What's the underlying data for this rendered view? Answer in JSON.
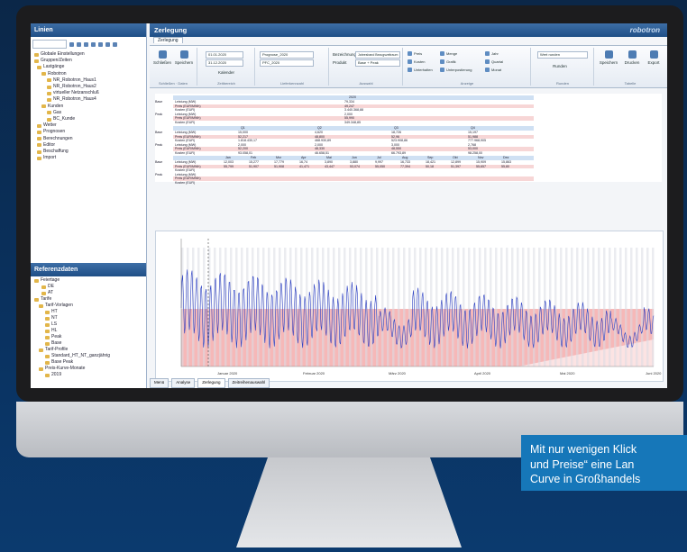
{
  "left_panel": {
    "title": "Linien",
    "tree": [
      "Globale Einstellungen",
      "Gruppen/Zeiten",
      "Lastgänge",
      "Robotron",
      "NR_Robotron_Haus1",
      "NR_Robotron_Haus2",
      "virtueller Netzanschluß",
      "NR_Robotron_Haus4",
      "Kunden",
      "Gas",
      "BC_Kunde",
      "Wetter",
      "Prognosen",
      "Berechnungen",
      "Editor",
      "Beschaffung",
      "Import"
    ]
  },
  "ref_panel": {
    "title": "Referenzdaten",
    "tree": [
      "Feiertage",
      "DE",
      "AT",
      "Tarife",
      "Tarif-Vorlagen",
      "HT",
      "NT",
      "LS",
      "HL",
      "Peak",
      "Base",
      "Tarif-Profile",
      "Standard_HT_NT_ganzjährig",
      "Base Peak",
      "Preis-Kurve-Monate",
      "2019"
    ]
  },
  "main": {
    "title": "Zerlegung",
    "brand": "robotron",
    "ribbon_tab": "Zerlegung",
    "ribbon": {
      "groups": [
        "Schließen",
        "Daten",
        "Zeitbereich",
        "Lieferkennzahl",
        "Auswahl",
        "Anzeige",
        "Runden",
        "Tabelle"
      ],
      "buttons": [
        "Schließen",
        "Speichern",
        "Kalender",
        "Runden",
        "Speichern",
        "Drucken",
        "Export"
      ],
      "date_from": "01.01.2020",
      "date_to": "31.12.2020",
      "prognose": "Prognose_2020",
      "prognose2": "PFC_2020",
      "bezeichnung_label": "Bezeichnung",
      "bezeichnung_value": "Jahresband Bezugszeitraum",
      "produkt_label": "Produkt",
      "produkt_value": "Base + Peak",
      "checks": [
        "Preis",
        "Kosten",
        "Menge",
        "Grafik",
        "Jahr",
        "Quartal",
        "Monat",
        "Wert runden"
      ],
      "checks_extra": [
        "Unterhalten",
        "Unterpostierung"
      ],
      "runden_value": "Wert runden",
      "jahr_value": "Jahr"
    },
    "table": {
      "year": "2020",
      "rows_label_left": [
        "Base",
        "",
        "",
        "",
        "Peak",
        "",
        "",
        ""
      ],
      "row_labels": [
        "Leistung (MW)",
        "Preis (EUR/MWh)",
        "Kosten (EUR)",
        "Leistung (MW)",
        "Preis (EUR/MWh)",
        "Kosten (EUR)"
      ],
      "year_values": [
        "79,334",
        "49,247",
        "3.440.368,88",
        "2,000",
        "55,990",
        "349.348,85"
      ],
      "quarters": [
        "Q1",
        "Q2",
        "Q3",
        "Q4"
      ],
      "quarter_values": [
        [
          "15,000",
          "52,217",
          "1.818.430,17",
          "2,000",
          "52,200",
          "93.058,01"
        ],
        [
          "4,620",
          "48,800",
          "468.930,89",
          "2,000",
          "48,330",
          "46.658,51"
        ],
        [
          "18,726",
          "52,96",
          "523.908,86",
          "3,000",
          "48,550",
          "66.793,89"
        ],
        [
          "15,197",
          "51,988",
          "777.968,905",
          "2,768",
          "53,000",
          "98.258,00"
        ]
      ],
      "months": [
        "Jan",
        "Feb",
        "Mrz",
        "Apr",
        "Mai",
        "Jun",
        "Jul",
        "Aug",
        "Sep",
        "Okt",
        "Nov",
        "Dez"
      ],
      "month_values": [
        [
          "12,003",
          "15,277",
          "17,779",
          "16,74",
          "3,890",
          "3,880",
          "9,997",
          "16,733",
          "18,421",
          "12,899",
          "15,909",
          "15,863"
        ],
        [
          "55,799",
          "51,907",
          "51,908",
          "41,471",
          "43,447",
          "53,074",
          "55,050",
          "77,394",
          "50,18",
          "51,397",
          "55,657",
          "55,80"
        ]
      ]
    },
    "chart": {
      "x_labels": [
        "Januar 2020",
        "Februar 2020",
        "März 2020",
        "April 2020",
        "Mai 2020",
        "Juni 2020"
      ]
    },
    "bottom_tabs": [
      "Menü",
      "Analyse",
      "Zerlegung",
      "Zeitreihenauswahl"
    ]
  },
  "caption": {
    "line1": "Mit nur wenigen Klick",
    "line2": "und Preise“ eine Lan",
    "line3": "Curve in Großhandels"
  },
  "chart_data": {
    "type": "area",
    "x_labels": [
      "Januar 2020",
      "Februar 2020",
      "März 2020",
      "April 2020",
      "Mai 2020",
      "Juni 2020"
    ]
  }
}
